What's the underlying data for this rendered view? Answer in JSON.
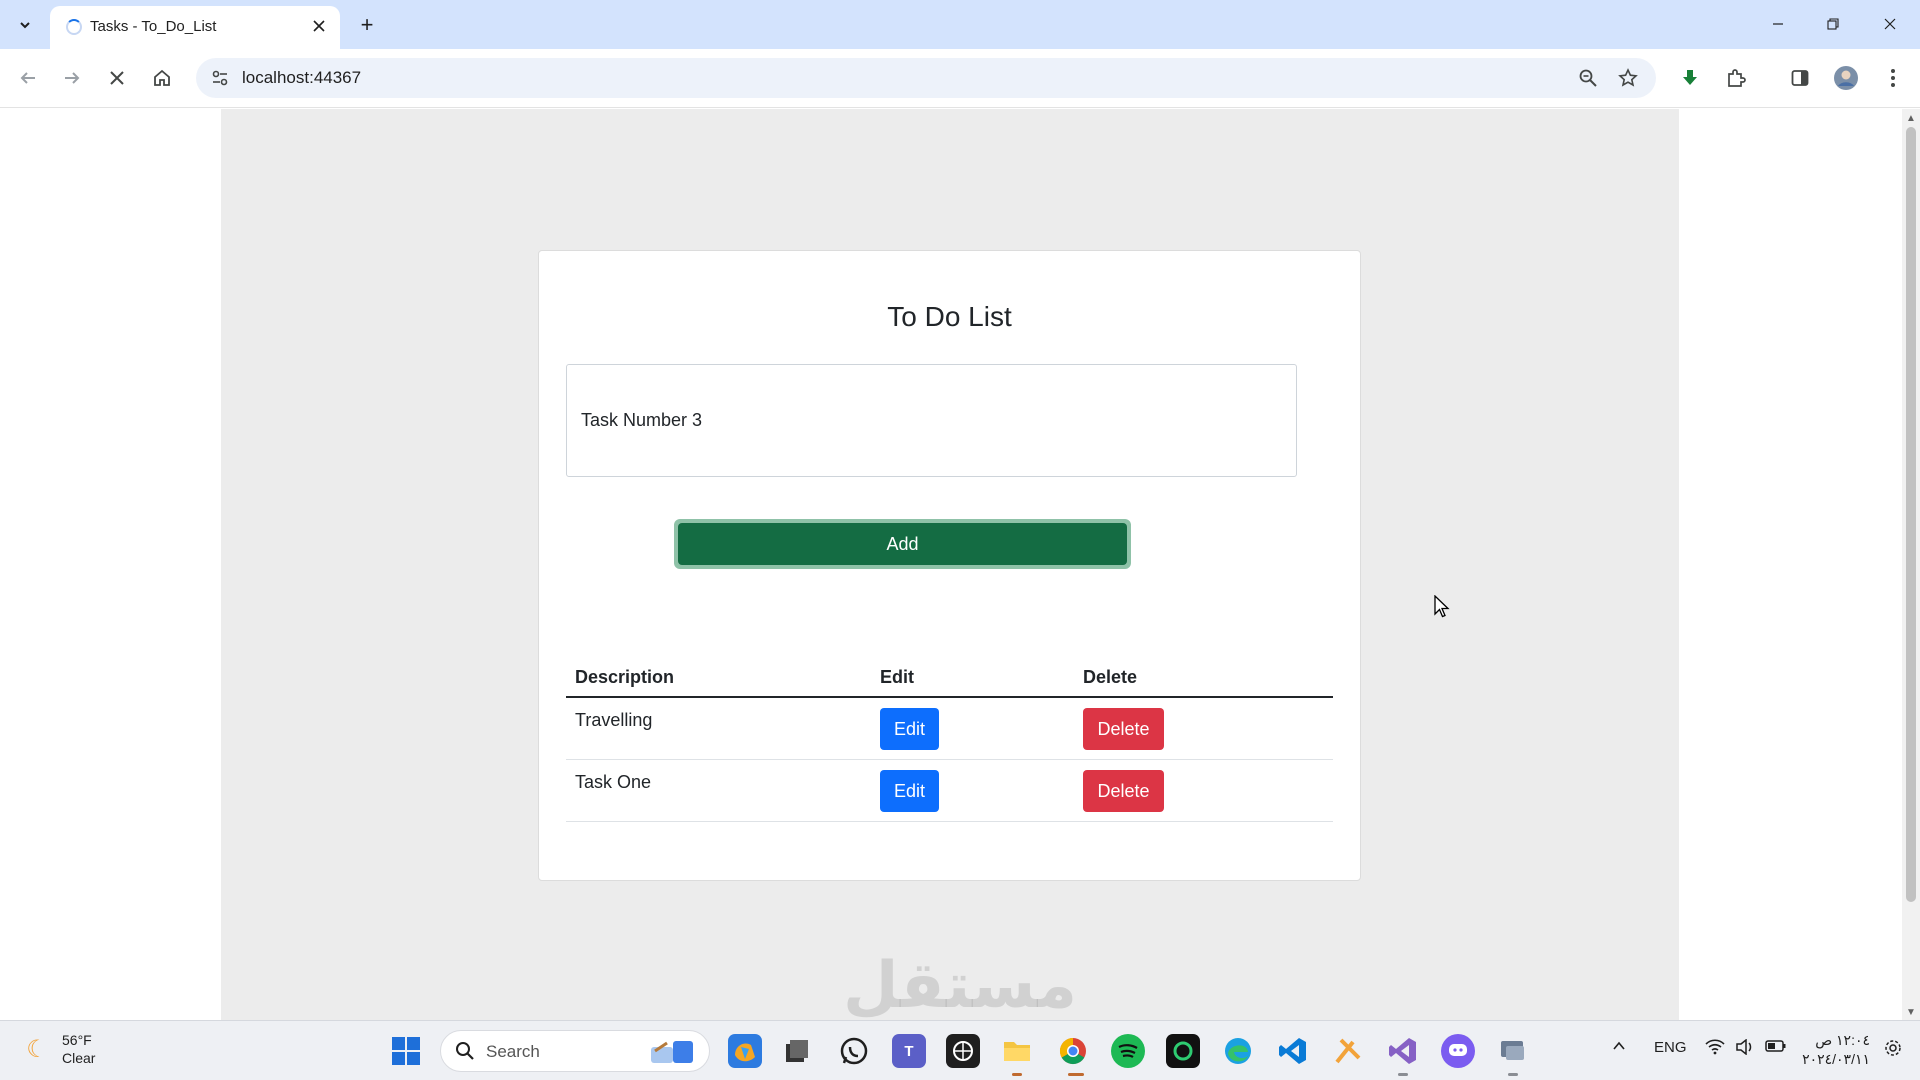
{
  "browser": {
    "tab_title": "Tasks - To_Do_List",
    "new_tab_symbol": "+",
    "url": "localhost:44367"
  },
  "page": {
    "title": "To Do List",
    "input_value": "Task Number 3",
    "add_label": "Add",
    "table": {
      "headers": [
        "Description",
        "Edit",
        "Delete"
      ],
      "rows": [
        {
          "description": "Travelling",
          "edit_label": "Edit",
          "delete_label": "Delete"
        },
        {
          "description": "Task One",
          "edit_label": "Edit",
          "delete_label": "Delete"
        }
      ]
    },
    "watermark": "مستقل"
  },
  "taskbar": {
    "weather_temp": "56°F",
    "weather_desc": "Clear",
    "search_placeholder": "Search",
    "language": "ENG",
    "time": "١٢:٠٤ ص",
    "date": "٢٠٢٤/٠٣/١١"
  },
  "colors": {
    "add_button": "#146c43",
    "edit_button": "#0d6efd",
    "delete_button": "#dc3545",
    "page_background": "#ececec"
  }
}
